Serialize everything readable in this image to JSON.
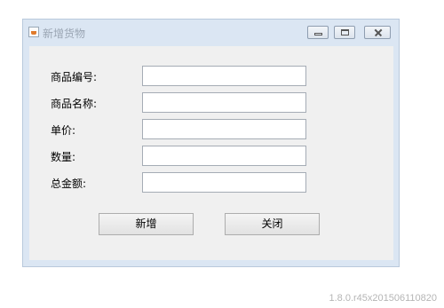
{
  "window": {
    "title": "新增货物",
    "icon": "java-cup-icon",
    "controls": [
      "minimize-icon",
      "maximize-icon",
      "close-icon"
    ]
  },
  "form": {
    "fields": [
      {
        "label": "商品编号:",
        "value": ""
      },
      {
        "label": "商品名称:",
        "value": ""
      },
      {
        "label": "单价:",
        "value": ""
      },
      {
        "label": "数量:",
        "value": ""
      },
      {
        "label": "总金额:",
        "value": ""
      }
    ]
  },
  "buttons": {
    "add_label": "新增",
    "close_label": "关闭"
  },
  "footer": {
    "version": "1.8.0.r45x201506110820"
  },
  "colors": {
    "frame": "#dbe6f3",
    "client": "#f0f0f0",
    "title_text": "#9aa5b3"
  }
}
